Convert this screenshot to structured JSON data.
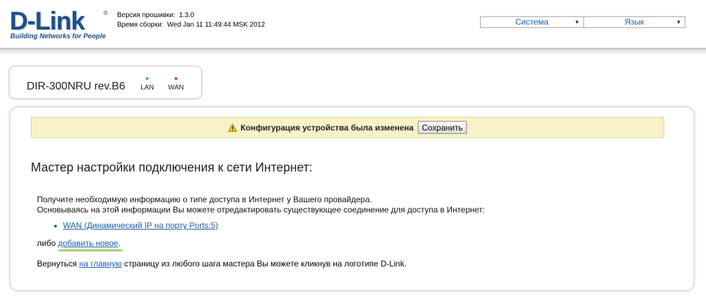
{
  "header": {
    "logo": {
      "word": "D-Link",
      "tm": "®",
      "tagline": "Building Networks for People"
    },
    "firmware_label": "Версия прошивки:",
    "firmware_value": "1.3.0",
    "build_label": "Время сборки:",
    "build_value": "Wed Jan 11 11:49:44 MSK 2012",
    "menus": [
      {
        "label": "Система"
      },
      {
        "label": "Язык"
      }
    ]
  },
  "device": {
    "name": "DIR-300NRU rev.B6",
    "indicators": [
      {
        "label": "LAN",
        "color": "#3fbf3f"
      },
      {
        "label": "WAN",
        "color": "#d03a2c"
      }
    ]
  },
  "notice": {
    "text": "Конфигурация устройства была изменена",
    "save_label": "Сохранить",
    "icon": "warning-icon"
  },
  "wizard": {
    "title": "Мастер настройки подключения к сети Интернет:",
    "line1": "Получите необходимую информацию о типе доступа в Интернет у Вашего провайдера.",
    "line2": "Основываясь на этой информации Вы можете отредактировать существующее соединение для доступа в Интернет:",
    "connection_link": "WAN (Динамический IP на порту Ports:5)",
    "or_prefix": "либо",
    "add_new_link": "добавить новое",
    "or_suffix": ".",
    "back_prefix": "Вернуться",
    "home_link": "на главную",
    "back_suffix": "страницу из любого шага мастера Вы можете кликнув на логотипе D-Link."
  },
  "colors": {
    "brand": "#1f4f8b",
    "link": "#1a5ea8",
    "notice_bg": "#f7f2c8"
  }
}
